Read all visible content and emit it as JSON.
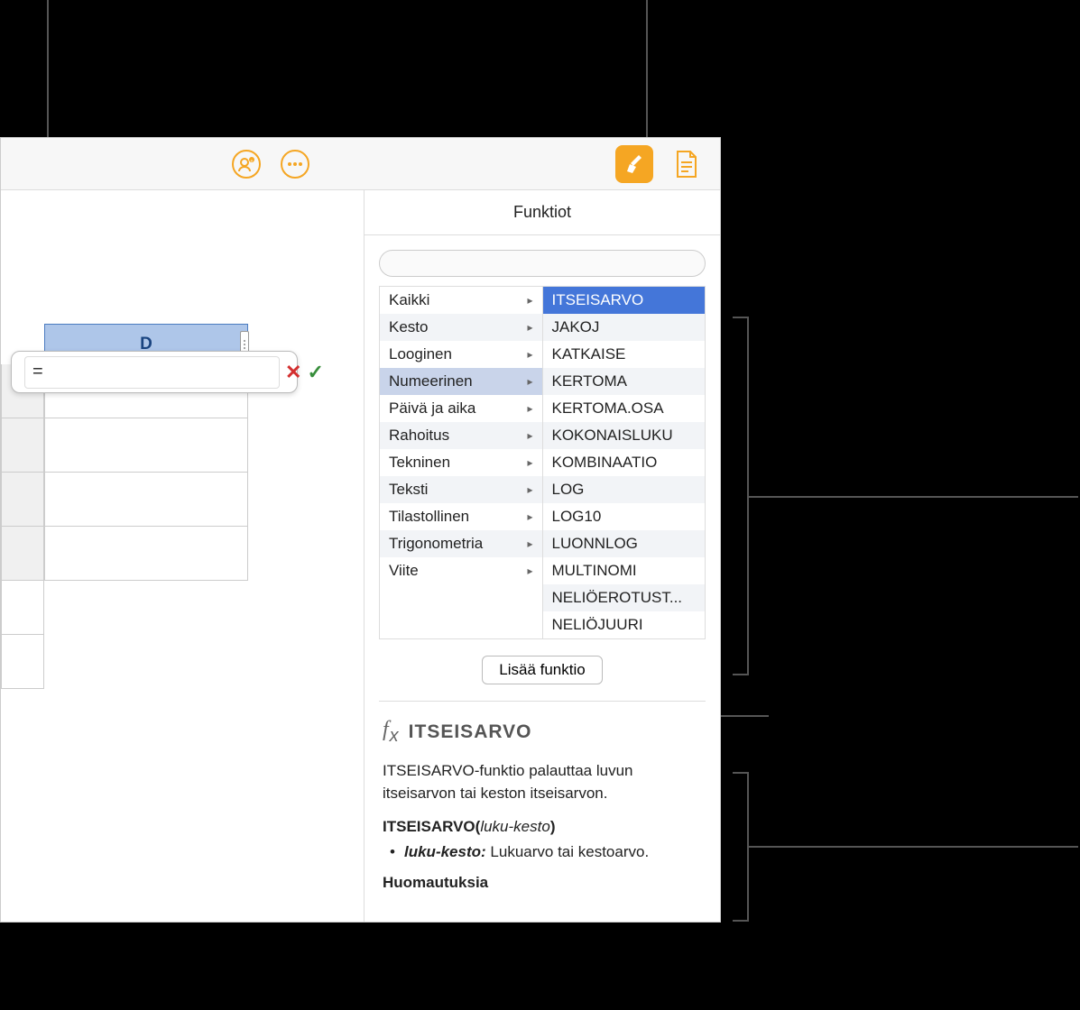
{
  "toolbar": {
    "column_label": "D",
    "formula_value": "="
  },
  "sidebar": {
    "title": "Funktiot",
    "search_placeholder": "",
    "categories": [
      "Kaikki",
      "Kesto",
      "Looginen",
      "Numeerinen",
      "Päivä ja aika",
      "Rahoitus",
      "Tekninen",
      "Teksti",
      "Tilastollinen",
      "Trigonometria",
      "Viite"
    ],
    "selected_category_index": 3,
    "functions": [
      "ITSEISARVO",
      "JAKOJ",
      "KATKAISE",
      "KERTOMA",
      "KERTOMA.OSA",
      "KOKONAISLUKU",
      "KOMBINAATIO",
      "LOG",
      "LOG10",
      "LUONNLOG",
      "MULTINOMI",
      "NELIÖEROTUST...",
      "NELIÖJUURI"
    ],
    "selected_function_index": 0,
    "insert_button": "Lisää funktio"
  },
  "help": {
    "title": "ITSEISARVO",
    "description": "ITSEISARVO-funktio palauttaa luvun itseisarvon tai keston itseisarvon.",
    "syntax_name": "ITSEISARVO",
    "syntax_param": "luku-kesto",
    "param_label": "luku-kesto:",
    "param_desc": "Lukuarvo tai kestoarvo.",
    "notes_label": "Huomautuksia"
  }
}
